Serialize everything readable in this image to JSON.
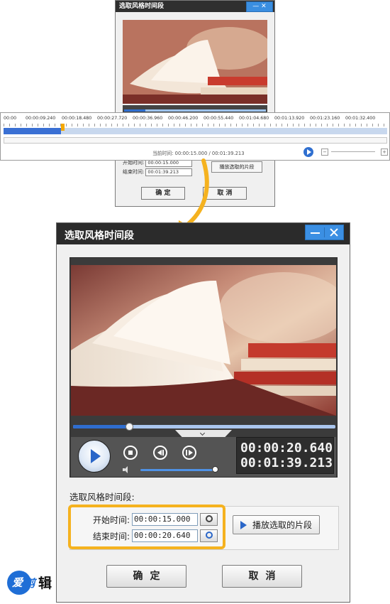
{
  "mini_dialog": {
    "title": "选取风格时间段",
    "start_label": "开始时间:",
    "start_value": "00:00:15.000",
    "end_label": "结束时间:",
    "end_value": "00:01:39.213",
    "play_selection": "播放选取的片段",
    "ok": "确 定",
    "cancel": "取 消"
  },
  "timeline": {
    "ticks": [
      "00:00",
      "00:00:09.240",
      "00:00:18.480",
      "00:00:27.720",
      "00:00:36.960",
      "00:00:46.200",
      "00:00:55.440",
      "00:01:04.680",
      "00:01:13.920",
      "00:01:23.160",
      "00:01:32.400"
    ],
    "current_label": "当前时间: 00:00:15.000 / 00:01:39.213",
    "played_fraction": 0.15
  },
  "dialog": {
    "title": "选取风格时间段",
    "current_time": "00:00:20.640",
    "total_time": "00:01:39.213",
    "section_label": "选取风格时间段:",
    "start_label": "开始时间:",
    "start_value": "00:00:15.000",
    "end_label": "结束时间:",
    "end_value": "00:00:20.640",
    "play_selection": "播放选取的片段",
    "ok": "确定",
    "cancel": "取消",
    "seek_fraction": 0.21,
    "volume_fraction": 1.0
  },
  "logo": {
    "text_1": "爱",
    "text_2": "剪",
    "text_3": "辑"
  },
  "colors": {
    "accent_blue": "#2f6fd0",
    "highlight_orange": "#f5b21f",
    "titlebar": "#2b2b2b"
  },
  "icons": [
    "play-icon",
    "stop-icon",
    "prev-frame-icon",
    "next-frame-icon",
    "volume-icon",
    "clock-icon",
    "minimize-icon",
    "close-icon"
  ]
}
